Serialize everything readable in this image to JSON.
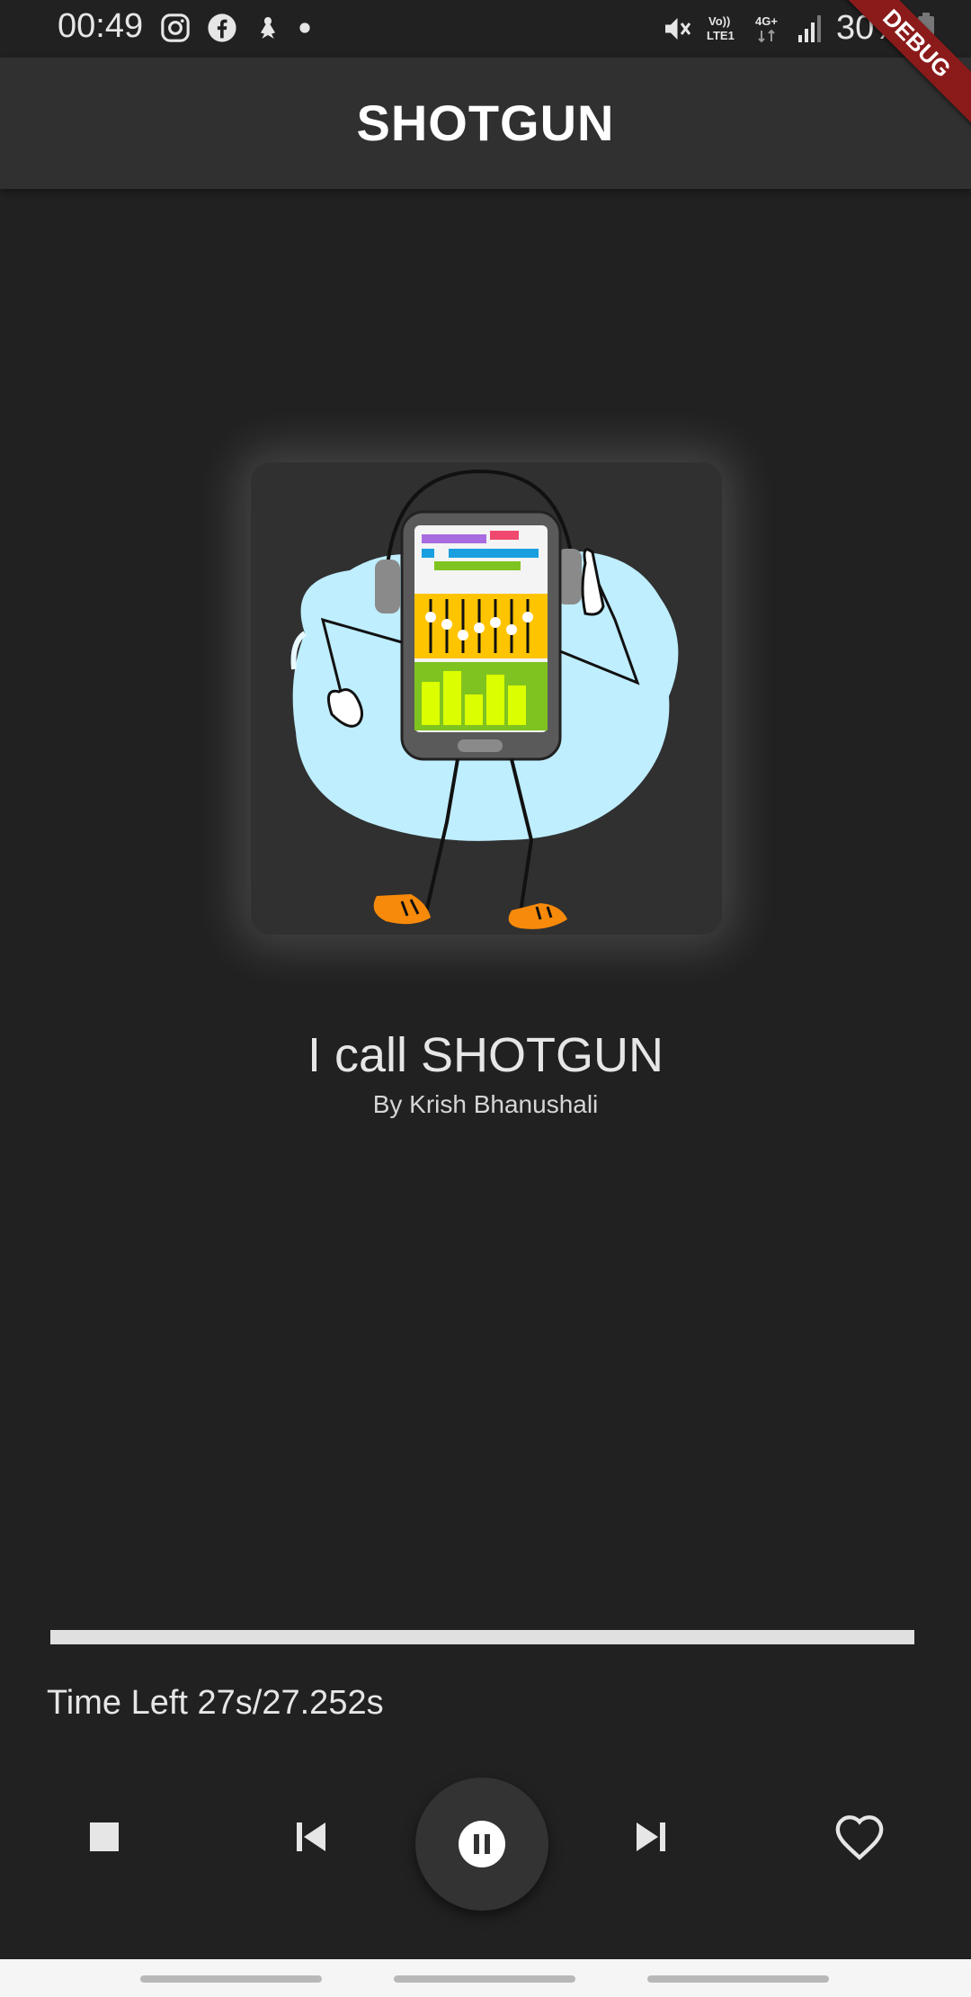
{
  "status_bar": {
    "time": "00:49",
    "battery": "30%",
    "network_lte": "LTE1",
    "network_4g": "4G+",
    "icons": [
      "instagram-icon",
      "facebook-icon",
      "notification-icon",
      "dot-icon",
      "mute-icon",
      "volte-icon",
      "signal-icon",
      "battery-icon"
    ]
  },
  "debug_banner": "DEBUG",
  "app_bar": {
    "title": "SHOTGUN"
  },
  "now_playing": {
    "title": "I call SHOTGUN",
    "artist": "By Krish Bhanushali",
    "time_left": "Time Left 27s/27.252s",
    "progress": 1.0
  },
  "controls": {
    "icons": [
      "stop-icon",
      "skip-previous-icon",
      "pause-icon",
      "skip-next-icon",
      "heart-outline-icon"
    ]
  },
  "colors": {
    "background": "#212121",
    "app_bar": "#303030",
    "progress": "#e0e0e0",
    "art_blob": "#bfeeff",
    "shoe": "#f78a0a"
  }
}
